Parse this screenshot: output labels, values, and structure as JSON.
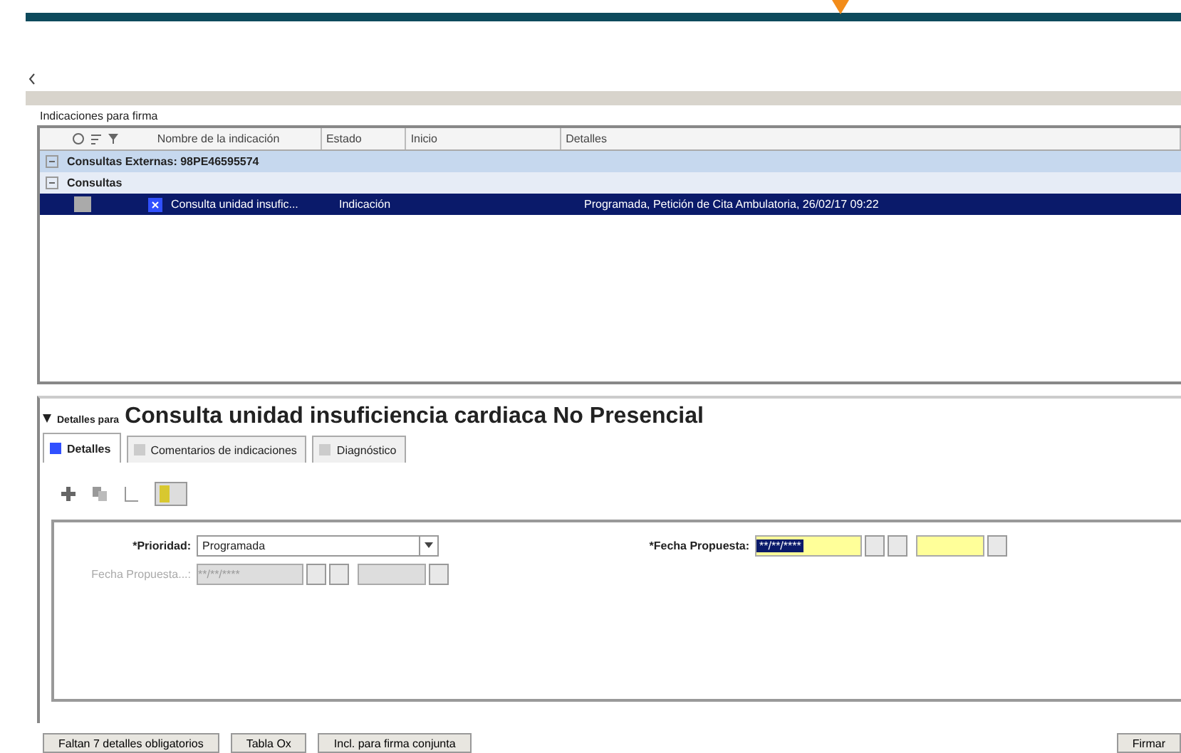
{
  "section_label": "Indicaciones para firma",
  "table": {
    "columns": [
      "Nombre de la indicación",
      "Estado",
      "Inicio",
      "Detalles"
    ],
    "groups": [
      {
        "label": "Consultas Externas: 98PE46595574",
        "expanded": true
      },
      {
        "label": "Consultas",
        "expanded": true
      }
    ],
    "rows": [
      {
        "name": "Consulta unidad insufic...",
        "status": "Indicación",
        "start": "",
        "details": "Programada, Petición de Cita Ambulatoria, 26/02/17 09:22",
        "selected": true
      }
    ]
  },
  "details": {
    "prefix": "Detalles para",
    "title": "Consulta unidad insuficiencia cardiaca No Presencial",
    "expanded": true
  },
  "tabs": [
    {
      "label": "Detalles",
      "selected": true
    },
    {
      "label": "Comentarios de indicaciones",
      "selected": false
    },
    {
      "label": "Diagnóstico",
      "selected": false
    }
  ],
  "form": {
    "priority": {
      "label": "*Prioridad:",
      "value": "Programada"
    },
    "proposed_date": {
      "label": "*Fecha Propuesta:",
      "value": "**/**/****"
    },
    "proposed_date_2": {
      "label": "Fecha Propuesta...:",
      "value": "**/**/****",
      "disabled": true
    }
  },
  "buttons": [
    {
      "label": "Faltan 7 detalles obligatorios"
    },
    {
      "label": "Tabla Ox"
    },
    {
      "label": "Incl. para firma conjunta"
    }
  ],
  "sign_button": "Firmar"
}
